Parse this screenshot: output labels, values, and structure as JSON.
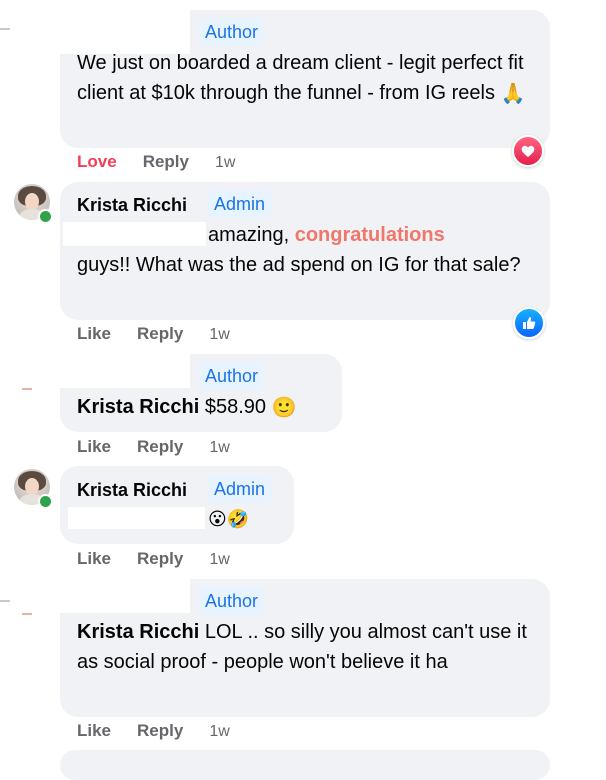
{
  "comments": [
    {
      "badge": "Author",
      "text": "We just on boarded a dream client - legit perfect fit client at $10k through the funnel - from IG reels",
      "emoji": "🙏",
      "actions": {
        "first": "Love",
        "reply": "Reply",
        "time": "1w"
      },
      "reaction": "love"
    },
    {
      "author": "Krista Ricchi",
      "badge": "Admin",
      "text_pre": "amazing, ",
      "text_highlight": "congratulations",
      "text_post": "guys!! What was the ad spend on IG for that sale?",
      "actions": {
        "first": "Like",
        "reply": "Reply",
        "time": "1w"
      },
      "reaction": "like"
    },
    {
      "badge": "Author",
      "mention": "Krista Ricchi",
      "text": "$58.90",
      "emoji": "🙂",
      "actions": {
        "first": "Like",
        "reply": "Reply",
        "time": "1w"
      }
    },
    {
      "author": "Krista Ricchi",
      "badge": "Admin",
      "emoji": "😮🤣",
      "actions": {
        "first": "Like",
        "reply": "Reply",
        "time": "1w"
      }
    },
    {
      "badge": "Author",
      "mention": "Krista Ricchi",
      "text": "LOL .. so silly you almost can't use it as social proof - people won't believe it ha",
      "actions": {
        "first": "Like",
        "reply": "Reply",
        "time": "1w"
      }
    }
  ],
  "colors": {
    "bubble": "#f0f2f5",
    "badge_text": "#1b74e4",
    "love": "#f33e58",
    "highlight": "#f0776a"
  }
}
